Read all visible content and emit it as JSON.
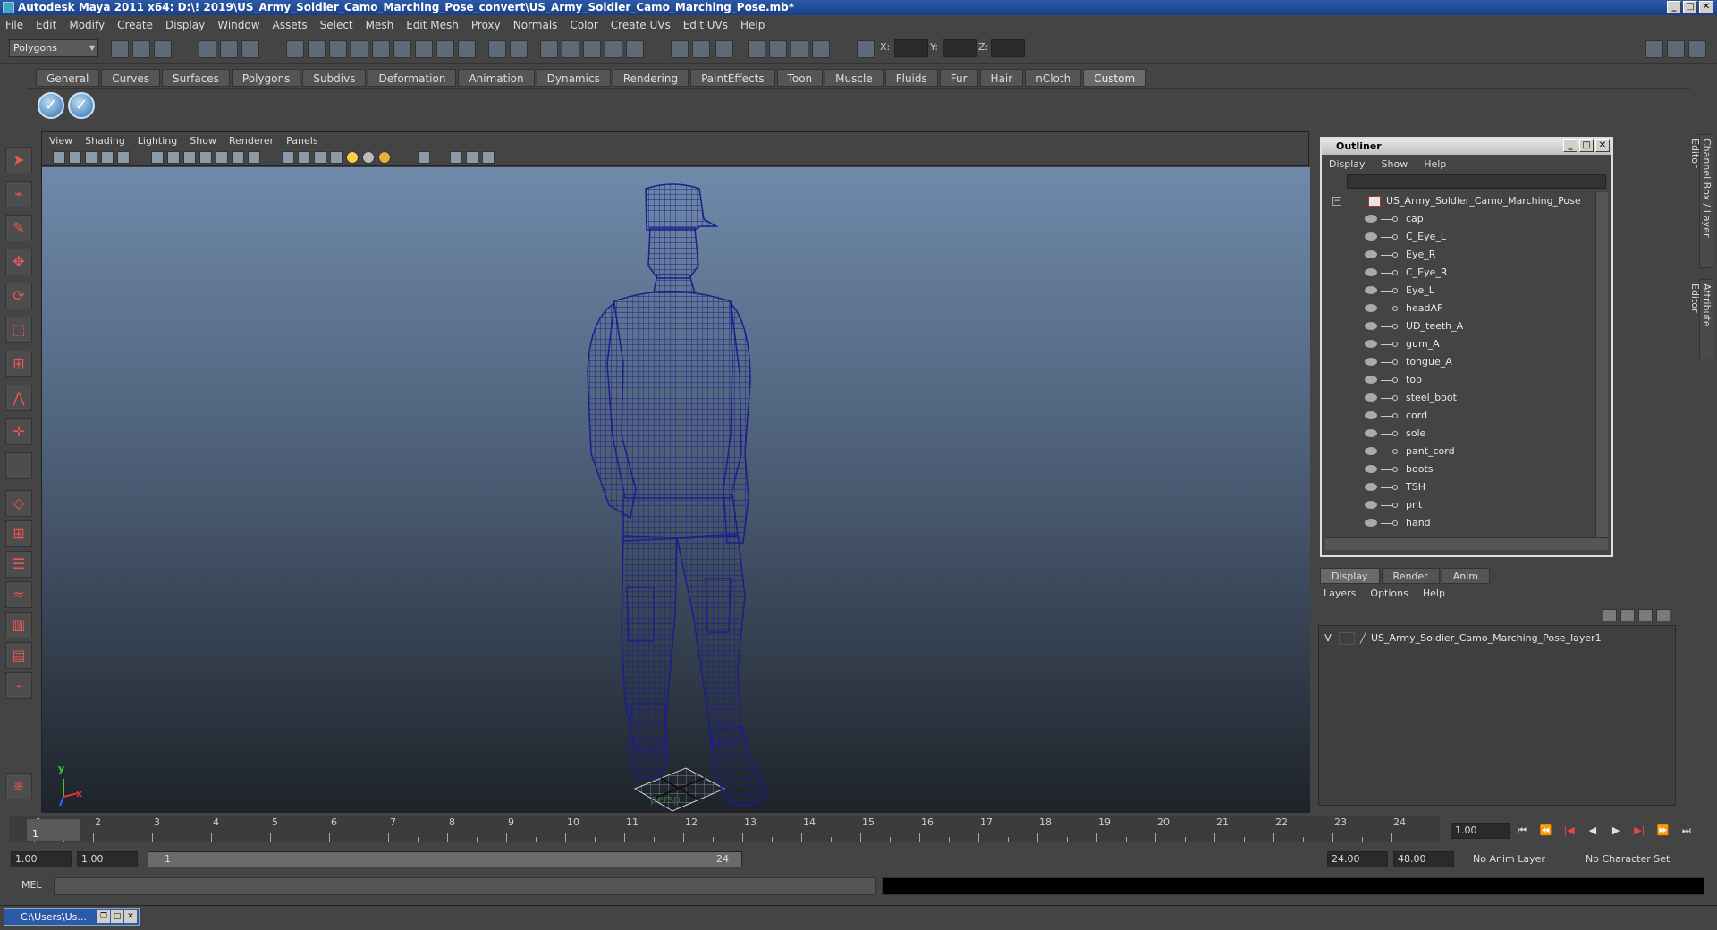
{
  "window": {
    "title": "Autodesk Maya 2011 x64: D:\\! 2019\\US_Army_Soldier_Camo_Marching_Pose_convert\\US_Army_Soldier_Camo_Marching_Pose.mb*",
    "buttons": [
      "_",
      "□",
      "✕"
    ]
  },
  "menubar": {
    "items": [
      "File",
      "Edit",
      "Modify",
      "Create",
      "Display",
      "Window",
      "Assets",
      "Select",
      "Mesh",
      "Edit Mesh",
      "Proxy",
      "Normals",
      "Color",
      "Create UVs",
      "Edit UVs",
      "Help"
    ]
  },
  "toolbar": {
    "mode": "Polygons",
    "x_label": "X:",
    "y_label": "Y:",
    "z_label": "Z:"
  },
  "shelf": {
    "tabs": [
      "General",
      "Curves",
      "Surfaces",
      "Polygons",
      "Subdivs",
      "Deformation",
      "Animation",
      "Dynamics",
      "Rendering",
      "PaintEffects",
      "Toon",
      "Muscle",
      "Fluids",
      "Fur",
      "Hair",
      "nCloth",
      "Custom"
    ],
    "active_tab": "Custom"
  },
  "viewport": {
    "menu": [
      "View",
      "Shading",
      "Lighting",
      "Show",
      "Renderer",
      "Panels"
    ],
    "camera_label": "persp",
    "axis_y": "y",
    "axis_x": "x",
    "wire_color": "#1a1f8a"
  },
  "outliner": {
    "title": "Outliner",
    "menu": [
      "Display",
      "Show",
      "Help"
    ],
    "root": "US_Army_Soldier_Camo_Marching_Pose",
    "root_expander": "−",
    "items": [
      "cap",
      "C_Eye_L",
      "Eye_R",
      "C_Eye_R",
      "Eye_L",
      "headAF",
      "UD_teeth_A",
      "gum_A",
      "tongue_A",
      "top",
      "steel_boot",
      "cord",
      "sole",
      "pant_cord",
      "boots",
      "TSH",
      "pnt",
      "hand"
    ]
  },
  "layer_editor": {
    "tabs": [
      "Display",
      "Render",
      "Anim"
    ],
    "active_tab": "Display",
    "menu": [
      "Layers",
      "Options",
      "Help"
    ],
    "layer": {
      "visible": "V",
      "name": "US_Army_Soldier_Camo_Marching_Pose_layer1"
    }
  },
  "side_tabs": [
    "Channel Box / Layer Editor",
    "Attribute Editor"
  ],
  "timeline": {
    "ticks": [
      "1",
      "2",
      "3",
      "4",
      "5",
      "6",
      "7",
      "8",
      "9",
      "10",
      "11",
      "12",
      "13",
      "14",
      "15",
      "16",
      "17",
      "18",
      "19",
      "20",
      "21",
      "22",
      "23",
      "24"
    ],
    "current_frame": "1.00",
    "current_marker": "1",
    "playback": [
      "⏮",
      "⏪",
      "|◀",
      "◀",
      "▶",
      "▶|",
      "⏩",
      "⏭"
    ]
  },
  "range": {
    "start": "1.00",
    "playback_start": "1.00",
    "slider_start": "1",
    "slider_end": "24",
    "playback_end": "24.00",
    "end": "48.00",
    "anim_layer": "No Anim Layer",
    "char_set": "No Character Set"
  },
  "command": {
    "label": "MEL"
  },
  "taskbar": {
    "item": "C:\\Users\\Us..."
  }
}
